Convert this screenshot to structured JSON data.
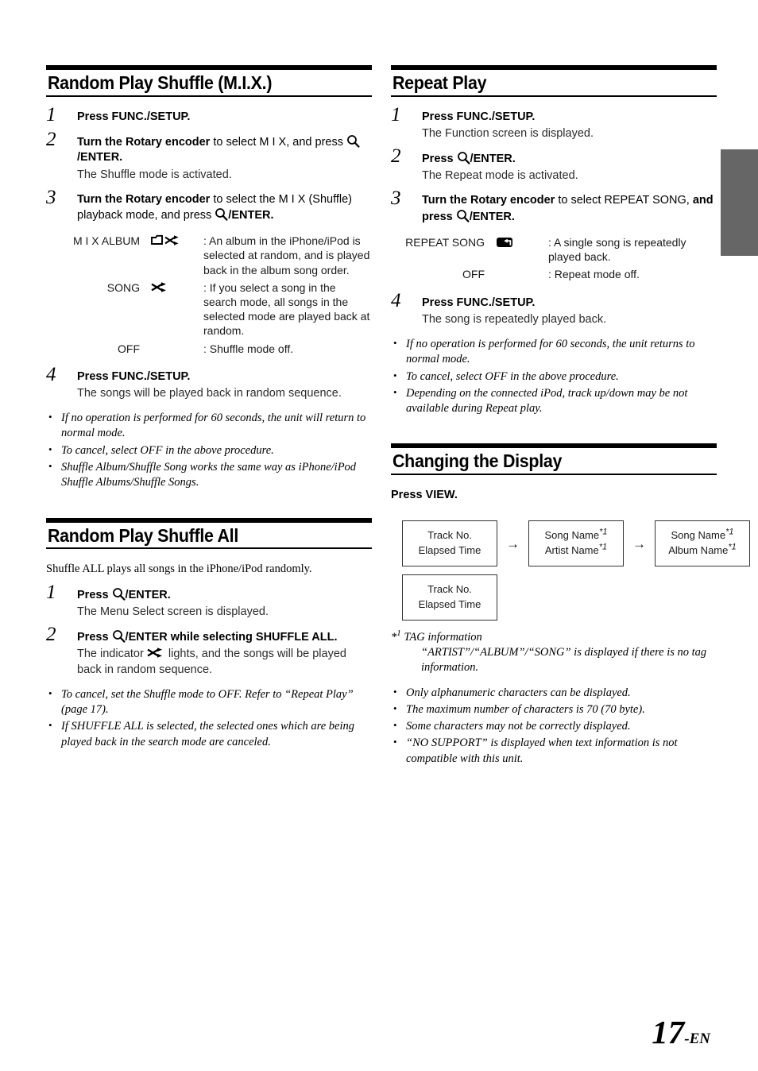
{
  "page": {
    "number": "17",
    "number_suffix": "-EN",
    "tab_color": "#666666"
  },
  "sections": [
    {
      "id": "random-play-shuffle-mix",
      "title": "Random Play Shuffle (M.I.X.)",
      "steps": [
        {
          "num": "1",
          "title_parts": [
            {
              "text": "Press ",
              "bold": true
            },
            {
              "text": "FUNC./SETUP",
              "bold": true
            },
            {
              "text": ".",
              "bold": true
            }
          ],
          "title_plain": "Press FUNC./SETUP.",
          "desc": ""
        },
        {
          "num": "2",
          "title_plain": "Turn the Rotary encoder to select M I X, and press /ENTER.",
          "desc": "The Shuffle mode is activated."
        },
        {
          "num": "3",
          "title_plain": "Turn the Rotary encoder to select the M I X (Shuffle) playback mode, and press /ENTER.",
          "desc": ""
        },
        {
          "num": "4",
          "title_plain": "Press FUNC./SETUP.",
          "desc": "The songs will be played back in random sequence."
        }
      ],
      "options": [
        {
          "name": "M I X ALBUM",
          "icon": "album-shuffle-icon",
          "desc": ": An album in the iPhone/iPod is selected at random, and is played back in the album song order."
        },
        {
          "name": "SONG",
          "icon": "shuffle-icon",
          "desc": ": If you select a song in the search mode, all songs in the selected mode are played back at random."
        },
        {
          "name": "OFF",
          "icon": "",
          "desc": ": Shuffle mode off."
        }
      ],
      "notes": [
        "If no operation is performed for 60 seconds, the unit will return to normal mode.",
        "To cancel, select OFF in the above procedure.",
        "Shuffle Album/Shuffle Song works the same way as iPhone/iPod Shuffle Albums/Shuffle Songs."
      ]
    },
    {
      "id": "random-play-shuffle-all",
      "title": "Random Play Shuffle All",
      "intro": "Shuffle ALL plays all songs in the iPhone/iPod randomly.",
      "steps": [
        {
          "num": "1",
          "title_plain": "Press /ENTER.",
          "desc": "The Menu Select screen is displayed."
        },
        {
          "num": "2",
          "title_plain": "Press /ENTER while selecting SHUFFLE ALL.",
          "desc_pre": "The indicator ",
          "desc_post": " lights, and the songs will be played back in random sequence."
        }
      ],
      "notes": [
        "To cancel, set the Shuffle mode to OFF. Refer to “Repeat Play” (page 17).",
        "If SHUFFLE ALL is selected, the selected ones which are being played back in the search mode are canceled."
      ]
    },
    {
      "id": "repeat-play",
      "title": "Repeat Play",
      "steps": [
        {
          "num": "1",
          "title_plain": "Press FUNC./SETUP.",
          "desc": "The Function screen is displayed."
        },
        {
          "num": "2",
          "title_plain": "Press /ENTER.",
          "desc": "The Repeat mode is activated."
        },
        {
          "num": "3",
          "title_plain": "Turn the Rotary encoder to select REPEAT SONG, and press /ENTER.",
          "desc": ""
        },
        {
          "num": "4",
          "title_plain": "Press FUNC./SETUP.",
          "desc": "The song is repeatedly played back."
        }
      ],
      "options": [
        {
          "name": "REPEAT SONG",
          "icon": "repeat-icon",
          "desc": ": A single song is repeatedly played back."
        },
        {
          "name": "OFF",
          "icon": "",
          "desc": ": Repeat mode off."
        }
      ],
      "notes": [
        "If no operation is performed for 60 seconds, the unit returns to normal mode.",
        "To cancel, select OFF in the above procedure.",
        "Depending on the connected iPod, track up/down may be not available during Repeat play."
      ]
    },
    {
      "id": "changing-the-display",
      "title": "Changing the Display",
      "instruction_plain": "Press VIEW.",
      "instruction_pre": "Press ",
      "instruction_key": "VIEW",
      "instruction_post": ".",
      "flow": {
        "arrow": "→",
        "boxes": [
          {
            "line1": "Track No.",
            "line2": "Elapsed Time",
            "star1": false,
            "star2": false
          },
          {
            "line1": "Song Name",
            "line2": "Artist Name",
            "star1": true,
            "star2": true
          },
          {
            "line1": "Song Name",
            "line2": "Album Name",
            "star1": true,
            "star2": true
          },
          {
            "line1": "Track No.",
            "line2": "Elapsed Time",
            "star1": false,
            "star2": false
          }
        ]
      },
      "footnote": {
        "marker": "*",
        "marker_sup": "1",
        "title": " TAG information",
        "body": "“ARTIST”/“ALBUM”/“SONG” is displayed if there is no tag information."
      },
      "notes": [
        "Only alphanumeric characters can be displayed.",
        "The maximum number of characters is 70 (70 byte).",
        "Some characters may not be correctly displayed.",
        "“NO SUPPORT” is displayed when text information is not compatible with this unit."
      ]
    }
  ],
  "labels": {
    "func_setup": "FUNC./SETUP",
    "enter": "/ENTER",
    "rotary_encoder": "Rotary encoder",
    "press": "Press ",
    "turn_the": "Turn the ",
    "to_select": " to select ",
    "and_press": ", and press ",
    "mix": "M I X",
    "mix_mode_tail": " (Shuffle) playback mode, and press ",
    "repeat_song": "REPEAT SONG",
    "and_press2": "and press ",
    "shuffle_all_tail": " while selecting SHUFFLE ALL."
  }
}
